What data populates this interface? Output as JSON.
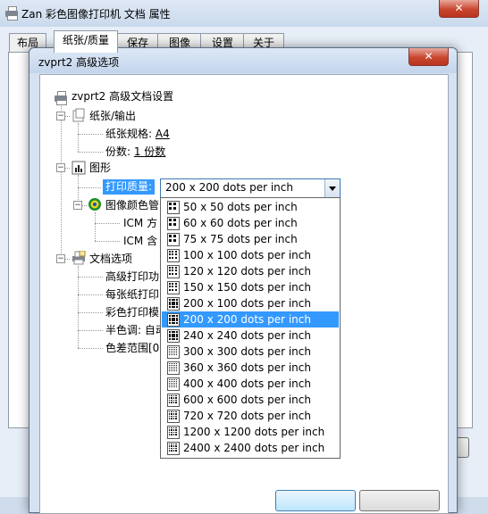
{
  "back_window": {
    "title": "Zan 彩色图像打印机 文档 属性",
    "close_glyph": "✕",
    "tabs": [
      "布局",
      "纸张/质量",
      "保存",
      "图像",
      "设置",
      "关于"
    ],
    "active_tab": 1
  },
  "dialog": {
    "title": "zvprt2 高级选项",
    "close_glyph": "✕"
  },
  "tree": {
    "root": "zvprt2 高级文档设置",
    "paper_output": {
      "label": "纸张/输出",
      "paper_size_label": "纸张规格: ",
      "paper_size_value": "A4",
      "copies_label": "份数: ",
      "copies_value": "1 份数"
    },
    "graphics": {
      "label": "图形",
      "print_quality_label": "打印质量: ",
      "color_mgmt_label": "图像颜色管",
      "icm_method": "ICM 方",
      "icm_intent": "ICM 含"
    },
    "doc_options": {
      "label": "文档选项",
      "items": [
        "高级打印功",
        "每张纸打印",
        "彩色打印模",
        "半色调: 自动",
        "色差范围[0"
      ]
    }
  },
  "combo": {
    "value": "200 x 200 dots per inch",
    "options": [
      "50 x 50 dots per inch",
      "60 x 60 dots per inch",
      "75 x 75 dots per inch",
      "100 x 100 dots per inch",
      "120 x 120 dots per inch",
      "150 x 150 dots per inch",
      "200 x 100 dots per inch",
      "200 x 200 dots per inch",
      "240 x 240 dots per inch",
      "300 x 300 dots per inch",
      "360 x 360 dots per inch",
      "400 x 400 dots per inch",
      "600 x 600 dots per inch",
      "720 x 720 dots per inch",
      "1200 x 1200 dots per inch",
      "2400 x 2400 dots per inch"
    ],
    "selected_index": 7
  }
}
